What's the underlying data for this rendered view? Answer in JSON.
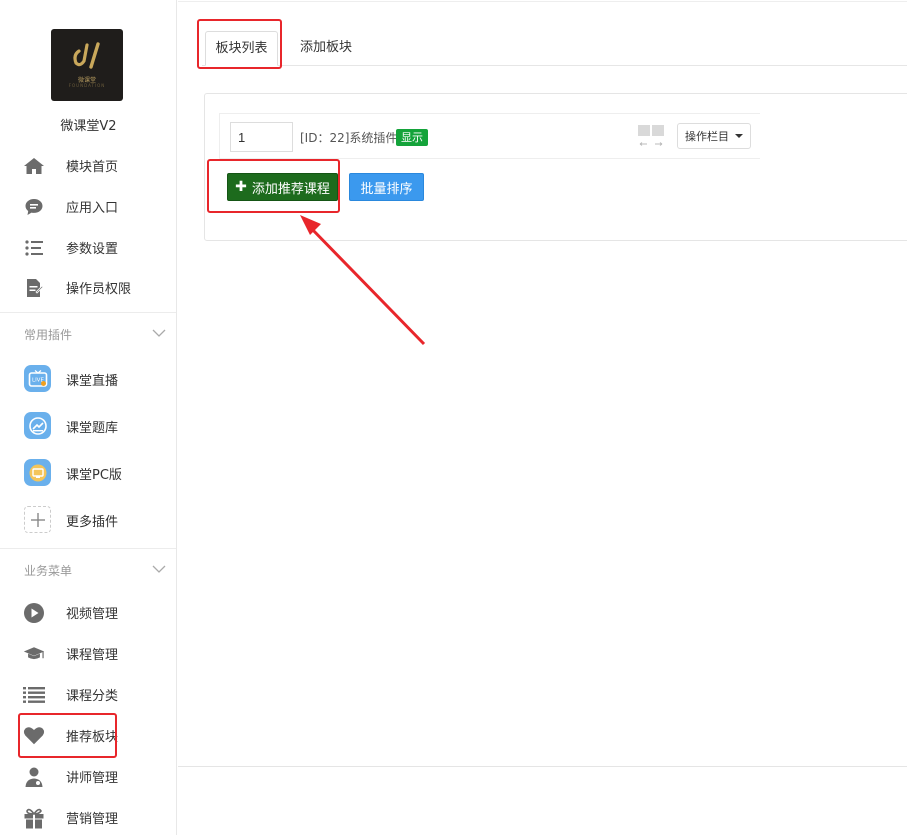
{
  "brand": {
    "name": "微课堂V2",
    "logo_caption": "微课堂",
    "logo_subcaption": "FOUNDATION"
  },
  "sidebar": {
    "main_items": [
      {
        "label": "模块首页",
        "icon": "home-icon"
      },
      {
        "label": "应用入口",
        "icon": "chat-bubble-icon"
      },
      {
        "label": "参数设置",
        "icon": "list-settings-icon"
      },
      {
        "label": "操作员权限",
        "icon": "document-edit-icon"
      }
    ],
    "plugins_group": {
      "title": "常用插件",
      "items": [
        {
          "label": "课堂直播",
          "icon": "live-tv-icon"
        },
        {
          "label": "课堂题库",
          "icon": "question-bank-icon"
        },
        {
          "label": "课堂PC版",
          "icon": "pc-version-icon"
        },
        {
          "label": "更多插件",
          "icon": "plus-icon"
        }
      ]
    },
    "business_group": {
      "title": "业务菜单",
      "items": [
        {
          "label": "视频管理",
          "icon": "play-circle-icon"
        },
        {
          "label": "课程管理",
          "icon": "graduation-cap-icon"
        },
        {
          "label": "课程分类",
          "icon": "list-icon"
        },
        {
          "label": "推荐板块",
          "icon": "heart-icon"
        },
        {
          "label": "讲师管理",
          "icon": "teacher-icon"
        },
        {
          "label": "营销管理",
          "icon": "gift-icon"
        }
      ]
    }
  },
  "tabs": [
    {
      "label": "板块列表",
      "active": true
    },
    {
      "label": "添加板块",
      "active": false
    }
  ],
  "block_row": {
    "order_value": "1",
    "title": "[ID：22]系统插件",
    "status_badge": "显示",
    "operation_label": "操作栏目"
  },
  "buttons": {
    "add_recommend": "添加推荐课程",
    "batch_sort": "批量排序"
  },
  "colors": {
    "badge_green": "#14a33a",
    "add_button_green": "#1d6b1d",
    "sort_button_blue": "#3b99ee",
    "annotation_red": "#e8262b",
    "plugin_icon_blue": "#6ab0ec"
  }
}
